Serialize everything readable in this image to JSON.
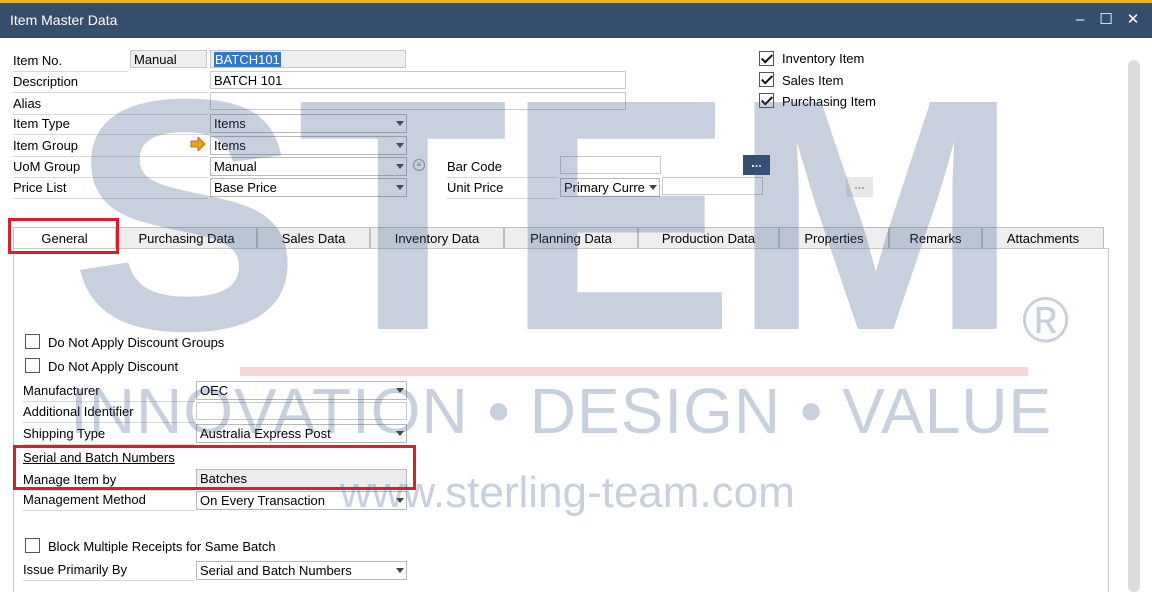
{
  "window": {
    "title": "Item Master Data"
  },
  "header": {
    "item_no_label": "Item No.",
    "item_no_series": "Manual",
    "item_no_value": "BATCH101",
    "description_label": "Description",
    "description_value": "BATCH 101",
    "alias_label": "Alias",
    "alias_value": "",
    "item_type_label": "Item Type",
    "item_type_value": "Items",
    "item_group_label": "Item Group",
    "item_group_value": "Items",
    "uom_group_label": "UoM Group",
    "uom_group_value": "Manual",
    "price_list_label": "Price List",
    "price_list_value": "Base Price",
    "bar_code_label": "Bar Code",
    "bar_code_value": "",
    "unit_price_label": "Unit Price",
    "unit_price_currency": "Primary Curre",
    "unit_price_value": "",
    "ellipsis": "..."
  },
  "flags": {
    "inventory_item": "Inventory Item",
    "sales_item": "Sales Item",
    "purchasing_item": "Purchasing Item"
  },
  "tabs": [
    {
      "label": "General"
    },
    {
      "label": "Purchasing Data"
    },
    {
      "label": "Sales Data"
    },
    {
      "label": "Inventory Data"
    },
    {
      "label": "Planning Data"
    },
    {
      "label": "Production Data"
    },
    {
      "label": "Properties"
    },
    {
      "label": "Remarks"
    },
    {
      "label": "Attachments"
    }
  ],
  "general": {
    "no_discount_groups": "Do Not Apply Discount Groups",
    "no_discount": "Do Not Apply Discount",
    "manufacturer_label": "Manufacturer",
    "manufacturer_value": "OEC",
    "additional_identifier_label": "Additional Identifier",
    "additional_identifier_value": "",
    "shipping_type_label": "Shipping Type",
    "shipping_type_value": "Australia Express Post",
    "serial_batch_section": "Serial and Batch Numbers",
    "manage_item_by_label": "Manage Item by",
    "manage_item_by_value": "Batches",
    "management_method_label": "Management Method",
    "management_method_value": "On Every Transaction",
    "block_multiple_receipts": "Block Multiple Receipts for Same Batch",
    "issue_primarily_by_label": "Issue Primarily By",
    "issue_primarily_by_value": "Serial and Batch Numbers"
  },
  "watermark": {
    "logo": "STEM",
    "registered": "®",
    "tagline": "INNOVATION • DESIGN • VALUE",
    "url": "www.sterling-team.com"
  },
  "colors": {
    "titlebar": "#354e6b",
    "accent": "#e8b12a",
    "highlight_box": "#d9202a",
    "watermark": "#3c5a8c"
  }
}
